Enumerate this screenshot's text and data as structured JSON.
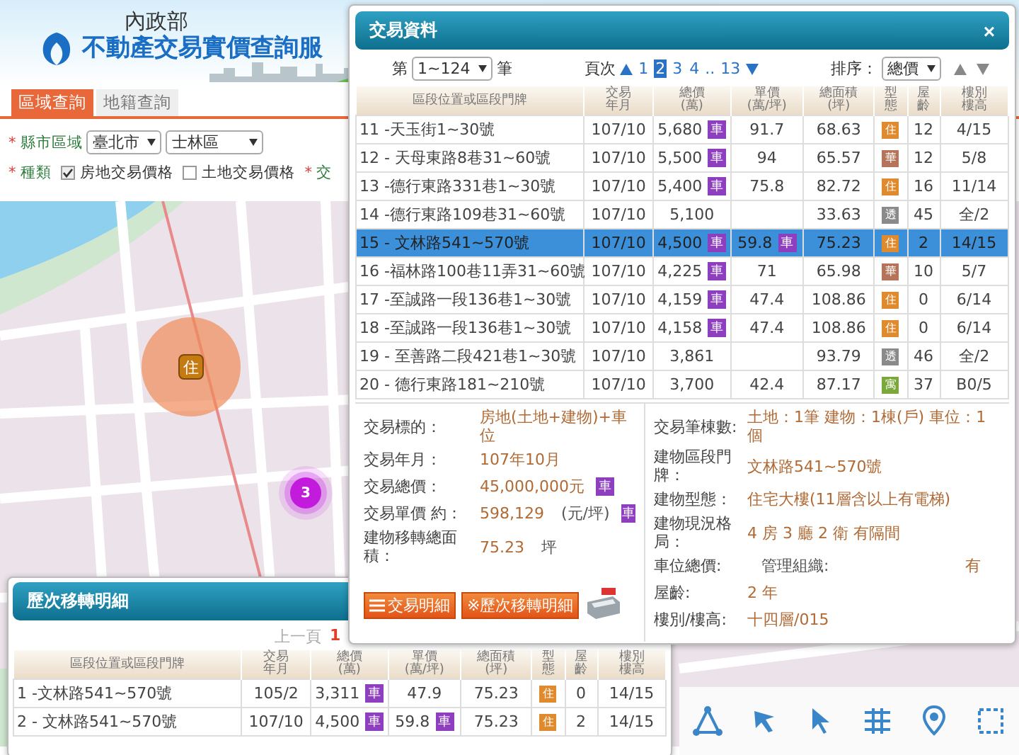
{
  "header": {
    "agency": "內政部",
    "service_title": "不動產交易實價查詢服"
  },
  "search_tabs": [
    {
      "label": "區域查詢",
      "selected": true
    },
    {
      "label": "地籍查詢",
      "selected": false
    }
  ],
  "filters": {
    "region": {
      "mark": "*",
      "label": "縣市區域",
      "city": "臺北市",
      "district": "士林區"
    },
    "category": {
      "mark": "*",
      "label": "種類",
      "options": [
        {
          "label": "房地交易價格",
          "checked": true
        },
        {
          "label": "土地交易價格",
          "checked": false
        }
      ]
    },
    "next": {
      "mark": "*",
      "label": "交"
    }
  },
  "map": {
    "markers": [
      {
        "kind": "property",
        "label": "住"
      },
      {
        "kind": "cluster",
        "label": "3"
      }
    ]
  },
  "history_panel": {
    "title": "歷次移轉明細",
    "pagination": {
      "prev": "上一頁",
      "current": "1"
    },
    "columns": [
      "區段位置或區段門牌",
      "交易年月",
      "總價(萬)",
      "單價(萬/坪)",
      "總面積(坪)",
      "型態",
      "屋齡",
      "樓別樓高"
    ],
    "rows": [
      {
        "address": "1 -文林路541~570號",
        "date": "105/2",
        "total": "3,311",
        "total_badge": "車",
        "unit": "47.9",
        "area": "75.23",
        "type": {
          "label": "住",
          "color": "#e08a2e"
        },
        "age": "0",
        "floor": "14/15"
      },
      {
        "address": "2 - 文林路541~570號",
        "date": "107/10",
        "total": "4,500",
        "total_badge": "車",
        "unit": "59.8",
        "unit_badge": "車",
        "area": "75.23",
        "type": {
          "label": "住",
          "color": "#e08a2e"
        },
        "age": "2",
        "floor": "14/15"
      }
    ]
  },
  "transaction_dialog": {
    "title": "交易資料",
    "close": "×",
    "record": {
      "prefix": "第",
      "range": "1~124",
      "suffix": "筆"
    },
    "paging": {
      "label": "頁次",
      "pages": [
        {
          "label": "1",
          "selected": false
        },
        {
          "label": "2",
          "selected": true
        },
        {
          "label": "3",
          "selected": false
        },
        {
          "label": "4",
          "selected": false
        }
      ],
      "ellipsis": "..",
      "last": "13"
    },
    "sort": {
      "label": "排序：",
      "value": "總價"
    },
    "columns": [
      "區段位置或區段門牌",
      "交易年月",
      "總價(萬)",
      "單價(萬/坪)",
      "總面積(坪)",
      "型態",
      "屋齡",
      "樓別樓高"
    ],
    "rows": [
      {
        "address": "11 -天玉街1~30號",
        "date": "107/10",
        "total": "5,680",
        "total_badge": "車",
        "unit": "91.7",
        "area": "68.63",
        "type": {
          "label": "住",
          "color": "#e08a2e"
        },
        "age": "12",
        "floor": "4/15",
        "selected": false
      },
      {
        "address": "12 - 天母東路8巷31~60號",
        "date": "107/10",
        "total": "5,500",
        "total_badge": "車",
        "unit": "94",
        "area": "65.57",
        "type": {
          "label": "華",
          "color": "#b5735a"
        },
        "age": "12",
        "floor": "5/8",
        "selected": false
      },
      {
        "address": "13 -德行東路331巷1~30號",
        "date": "107/10",
        "total": "5,400",
        "total_badge": "車",
        "unit": "75.8",
        "area": "82.72",
        "type": {
          "label": "住",
          "color": "#e08a2e"
        },
        "age": "16",
        "floor": "11/14",
        "selected": false
      },
      {
        "address": "14 -德行東路109巷31~60號",
        "date": "107/10",
        "total": "5,100",
        "area": "33.63",
        "type": {
          "label": "透",
          "color": "#8a8a8a"
        },
        "age": "45",
        "floor": "全/2",
        "selected": false
      },
      {
        "address": "15 - 文林路541~570號",
        "date": "107/10",
        "total": "4,500",
        "total_badge": "車",
        "unit": "59.8",
        "unit_badge": "車",
        "area": "75.23",
        "type": {
          "label": "住",
          "color": "#e08a2e"
        },
        "age": "2",
        "floor": "14/15",
        "selected": true
      },
      {
        "address": "16 -福林路100巷11弄31~60號",
        "date": "107/10",
        "total": "4,225",
        "total_badge": "車",
        "unit": "71",
        "area": "65.98",
        "type": {
          "label": "華",
          "color": "#b5735a"
        },
        "age": "10",
        "floor": "5/7",
        "selected": false
      },
      {
        "address": "17 -至誠路一段136巷1~30號",
        "date": "107/10",
        "total": "4,159",
        "total_badge": "車",
        "unit": "47.4",
        "area": "108.86",
        "type": {
          "label": "住",
          "color": "#e08a2e"
        },
        "age": "0",
        "floor": "6/14",
        "selected": false
      },
      {
        "address": "18 -至誠路一段136巷1~30號",
        "date": "107/10",
        "total": "4,158",
        "total_badge": "車",
        "unit": "47.4",
        "area": "108.86",
        "type": {
          "label": "住",
          "color": "#e08a2e"
        },
        "age": "0",
        "floor": "6/14",
        "selected": false
      },
      {
        "address": "19 - 至善路二段421巷1~30號",
        "date": "107/10",
        "total": "3,861",
        "area": "93.79",
        "type": {
          "label": "透",
          "color": "#8a8a8a"
        },
        "age": "46",
        "floor": "全/2",
        "selected": false
      },
      {
        "address": "20 - 德行東路181~210號",
        "date": "107/10",
        "total": "3,700",
        "unit": "42.4",
        "area": "87.17",
        "type": {
          "label": "寓",
          "color": "#7aa83a"
        },
        "age": "37",
        "floor": "B0/5",
        "selected": false
      }
    ],
    "details_left": [
      {
        "label": "交易標的：",
        "value": "房地(土地+建物)+車位"
      },
      {
        "label": "交易年月：",
        "value": "107年10月"
      },
      {
        "label": "交易總價：",
        "value": "45,000,000元",
        "badge": "車"
      },
      {
        "label": "交易單價 約：",
        "value": "598,129",
        "unit": "(元/坪)",
        "badge": "車"
      },
      {
        "label": "建物移轉總面積：",
        "value": "75.23",
        "unit": "坪"
      }
    ],
    "details_right": [
      {
        "label": "交易筆棟數:",
        "value": "土地：1筆 建物：1棟(戶) 車位：1個"
      },
      {
        "label": "建物區段門牌：",
        "value": "文林路541~570號"
      },
      {
        "label": "建物型態：",
        "value": "住宅大樓(11層含以上有電梯)"
      },
      {
        "label": "建物現況格局：",
        "value": "4 房 3 廳 2 衛 有隔間"
      },
      {
        "label": "車位總價:",
        "extra_label": "管理組織:",
        "extra_value": "有"
      },
      {
        "label": "屋齡:",
        "value": "2 年"
      },
      {
        "label": "樓別/樓高:",
        "value": "十四層/015"
      }
    ],
    "buttons": [
      {
        "kind": "list",
        "label": "交易明細"
      },
      {
        "kind": "history",
        "label": "※歷次移轉明細"
      }
    ]
  }
}
